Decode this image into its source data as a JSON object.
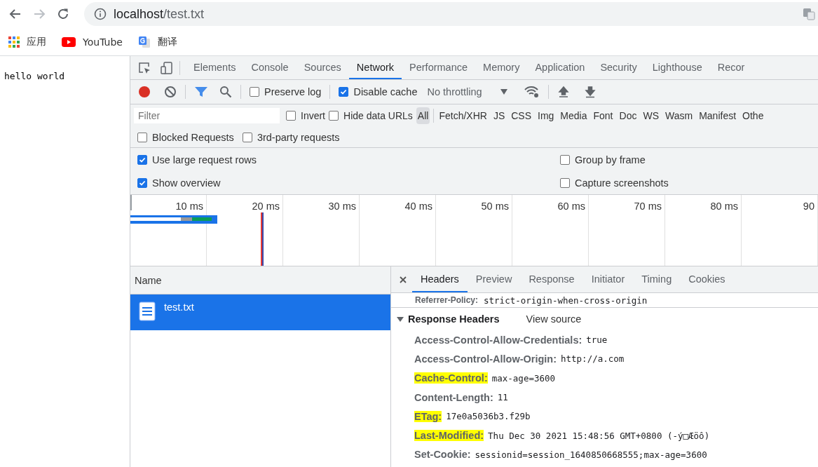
{
  "browser": {
    "url_host": "localhost",
    "url_path": "/test.txt",
    "bookmarks": [
      {
        "kind": "apps",
        "label": "应用"
      },
      {
        "kind": "video",
        "label": "YouTube"
      },
      {
        "kind": "translate",
        "label": "翻译"
      }
    ]
  },
  "page": {
    "text": "hello world"
  },
  "devtools": {
    "tabs": [
      {
        "label": "Elements",
        "selected": false
      },
      {
        "label": "Console",
        "selected": false
      },
      {
        "label": "Sources",
        "selected": false
      },
      {
        "label": "Network",
        "selected": true
      },
      {
        "label": "Performance",
        "selected": false
      },
      {
        "label": "Memory",
        "selected": false
      },
      {
        "label": "Application",
        "selected": false
      },
      {
        "label": "Security",
        "selected": false
      },
      {
        "label": "Lighthouse",
        "selected": false
      },
      {
        "label": "Recor",
        "selected": false
      }
    ],
    "toolbar": {
      "recording": true,
      "preserve_log": {
        "label": "Preserve log",
        "checked": false
      },
      "disable_cache": {
        "label": "Disable cache",
        "checked": true
      },
      "throttling": "No throttling"
    },
    "filter": {
      "placeholder": "Filter",
      "invert": {
        "label": "Invert",
        "checked": false
      },
      "hide_data_urls": {
        "label": "Hide data URLs",
        "checked": false
      },
      "types": [
        {
          "label": "All",
          "selected": true
        },
        {
          "label": "Fetch/XHR",
          "selected": false
        },
        {
          "label": "JS",
          "selected": false
        },
        {
          "label": "CSS",
          "selected": false
        },
        {
          "label": "Img",
          "selected": false
        },
        {
          "label": "Media",
          "selected": false
        },
        {
          "label": "Font",
          "selected": false
        },
        {
          "label": "Doc",
          "selected": false
        },
        {
          "label": "WS",
          "selected": false
        },
        {
          "label": "Wasm",
          "selected": false
        },
        {
          "label": "Manifest",
          "selected": false
        },
        {
          "label": "Othe",
          "selected": false
        }
      ],
      "extra": [
        {
          "label": "Blocked Requests",
          "checked": false
        },
        {
          "label": "3rd-party requests",
          "checked": false
        }
      ]
    },
    "settings": [
      {
        "label": "Use large request rows",
        "checked": true
      },
      {
        "label": "Group by frame",
        "checked": false
      },
      {
        "label": "Show overview",
        "checked": true
      },
      {
        "label": "Capture screenshots",
        "checked": false
      }
    ],
    "overview": {
      "ticks": [
        "10 ms",
        "20 ms",
        "30 ms",
        "40 ms",
        "50 ms",
        "60 ms",
        "70 ms",
        "80 ms",
        "90"
      ]
    },
    "requests": {
      "column": "Name",
      "rows": [
        {
          "name": "test.txt",
          "selected": true
        }
      ]
    },
    "details": {
      "tabs": [
        {
          "label": "Headers",
          "selected": true
        },
        {
          "label": "Preview",
          "selected": false
        },
        {
          "label": "Response",
          "selected": false
        },
        {
          "label": "Initiator",
          "selected": false
        },
        {
          "label": "Timing",
          "selected": false
        },
        {
          "label": "Cookies",
          "selected": false
        }
      ],
      "clipped_header": {
        "name": "Referrer-Policy:",
        "value": "strict-origin-when-cross-origin"
      },
      "section": {
        "title": "Response Headers",
        "expanded": true,
        "action": "View source"
      },
      "headers": [
        {
          "name": "Access-Control-Allow-Credentials:",
          "value": "true",
          "highlighted": false
        },
        {
          "name": "Access-Control-Allow-Origin:",
          "value": "http://a.com",
          "highlighted": false
        },
        {
          "name": "Cache-Control:",
          "value": "max-age=3600",
          "highlighted": true
        },
        {
          "name": "Content-Length:",
          "value": "11",
          "highlighted": false
        },
        {
          "name": "ETag:",
          "value": "17e0a5036b3.f29b",
          "highlighted": true
        },
        {
          "name": "Last-Modified:",
          "value": "Thu Dec 30 2021 15:48:56 GMT+0800 (-ý□Æöô)",
          "highlighted": true
        },
        {
          "name": "Set-Cookie:",
          "value": "sessionid=session_1640850668555;max-age=3600",
          "highlighted": false
        }
      ]
    }
  }
}
